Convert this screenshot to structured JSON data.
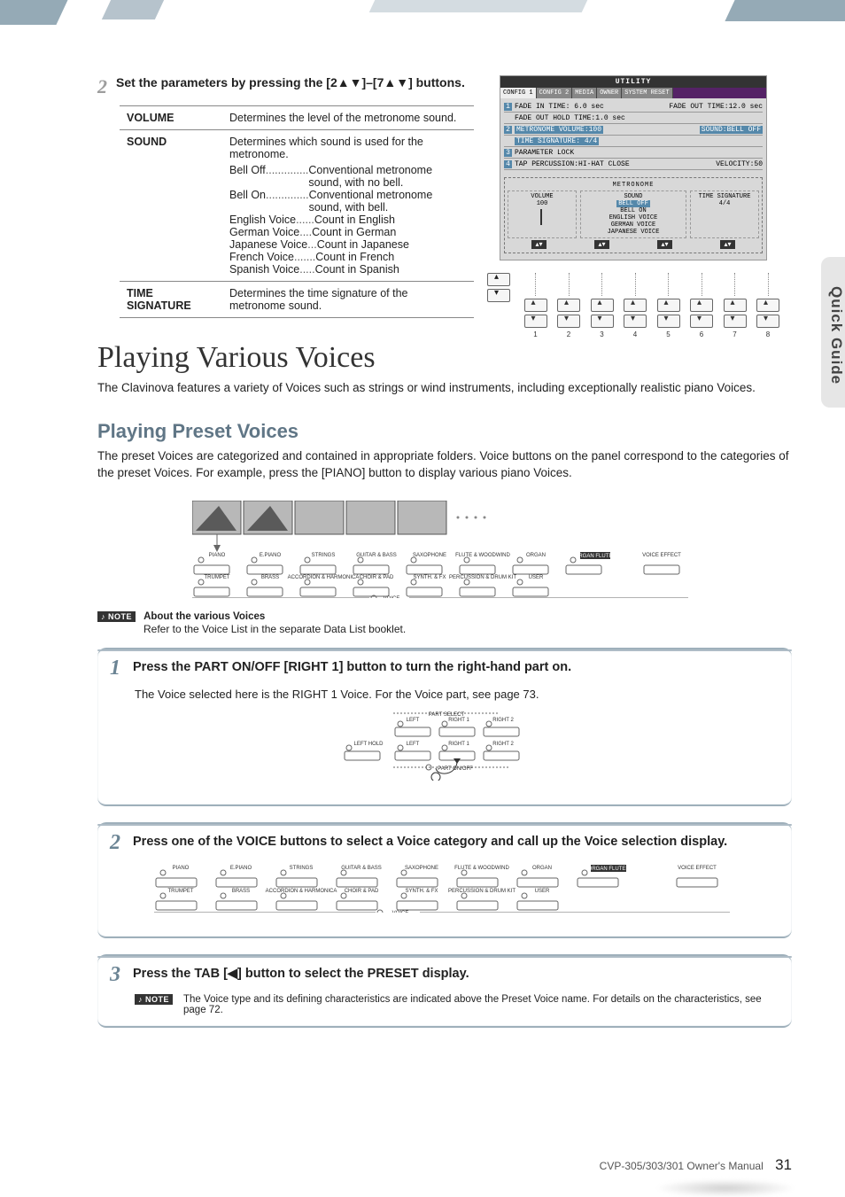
{
  "side_tab": "Quick Guide",
  "step2": {
    "num": "2",
    "text": "Set the parameters by pressing the [2▲▼]–[7▲▼] buttons."
  },
  "param_table": {
    "rows": [
      {
        "key": "VOLUME",
        "desc": "Determines the level of the metronome sound."
      },
      {
        "key": "SOUND",
        "desc": "Determines which sound is used for the metronome.",
        "items": [
          {
            "k": "Bell Off",
            "dots": "..............",
            "v": "Conventional metronome sound, with no bell."
          },
          {
            "k": "Bell On",
            "dots": "..............",
            "v": "Conventional metronome sound, with bell."
          },
          {
            "k": "English Voice",
            "dots": " ......",
            "v": "Count in English"
          },
          {
            "k": "German Voice",
            "dots": " ....",
            "v": "Count in German"
          },
          {
            "k": "Japanese Voice",
            "dots": " ...",
            "v": "Count in Japanese"
          },
          {
            "k": "French Voice",
            "dots": ".......",
            "v": "Count in French"
          },
          {
            "k": "Spanish Voice",
            "dots": " .....",
            "v": "Count in Spanish"
          }
        ]
      },
      {
        "key": "TIME SIGNATURE",
        "desc": "Determines the time signature of the metronome sound."
      }
    ]
  },
  "utility": {
    "title": "UTILITY",
    "tabs": [
      "CONFIG 1",
      "CONFIG 2",
      "MEDIA",
      "OWNER",
      "SYSTEM RESET"
    ],
    "rows": {
      "r1a": "FADE IN TIME: 6.0 sec",
      "r1b": "FADE OUT TIME:12.0 sec",
      "r1c": "FADE OUT HOLD TIME:1.0 sec",
      "r2a": "METRONOME VOLUME:100",
      "r2b": "SOUND:BELL OFF",
      "r2c": "TIME SIGNATURE:  4/4",
      "r3": "PARAMETER LOCK",
      "r4a": "TAP PERCUSSION:HI-HAT CLOSE",
      "r4b": "VELOCITY:50"
    },
    "metronome": {
      "title": "METRONOME",
      "vol_label": "VOLUME",
      "vol_val": "100",
      "sound_label": "SOUND",
      "sound_sel": "BELL OFF",
      "sounds": [
        "BELL ON",
        "ENGLISH VOICE",
        "GERMAN VOICE",
        "JAPANESE VOICE"
      ],
      "ts_label": "TIME SIGNATURE",
      "ts_val": "4/4"
    },
    "button_numbers": [
      "1",
      "2",
      "3",
      "4",
      "5",
      "6",
      "7",
      "8"
    ]
  },
  "section": {
    "title": "Playing Various Voices",
    "body": "The Clavinova features a variety of Voices such as strings or wind instruments, including exceptionally realistic piano Voices."
  },
  "subsection": {
    "title": "Playing Preset Voices",
    "body": "The preset Voices are categorized and contained in appropriate folders. Voice buttons on the panel correspond to the categories of the preset Voices. For example, press the [PIANO] button to display various piano Voices."
  },
  "voice_categories_row1": [
    "PIANO",
    "E.PIANO",
    "STRINGS",
    "GUITAR & BASS",
    "SAXOPHONE",
    "FLUTE & WOODWIND",
    "ORGAN",
    "ORGAN FLUTES"
  ],
  "voice_categories_row2": [
    "TRUMPET",
    "BRASS",
    "ACCORDION & HARMONICA",
    "CHOIR & PAD",
    "SYNTH. & FX",
    "PERCUSSION & DRUM KIT",
    "USER"
  ],
  "voice_effect": "VOICE EFFECT",
  "voice_group_label": "VOICE",
  "note_about": {
    "tag": "♪ NOTE",
    "label": "About the various Voices",
    "body": "Refer to the Voice List in the separate Data List booklet."
  },
  "proc1": {
    "num": "1",
    "title": "Press the PART ON/OFF [RIGHT 1] button to turn the right-hand part on.",
    "body": "The Voice selected here is the RIGHT 1 Voice. For the Voice part, see page 73.",
    "part_select": {
      "group_top": "PART SELECT",
      "labels_top": [
        "LEFT",
        "RIGHT 1",
        "RIGHT 2"
      ],
      "left_hold": "LEFT HOLD",
      "labels_mid": [
        "LEFT",
        "RIGHT 1",
        "RIGHT 2"
      ],
      "group_bottom": "PART ON/OFF"
    }
  },
  "proc2": {
    "num": "2",
    "title": "Press one of the VOICE buttons to select a Voice category and call up the Voice selection display."
  },
  "proc3": {
    "num": "3",
    "title": "Press the TAB [◀] button to select the PRESET display.",
    "note": "The Voice type and its defining characteristics are indicated above the Preset Voice name. For details on the characteristics, see page 72."
  },
  "footer": {
    "model": "CVP-305/303/301 Owner's Manual",
    "page": "31"
  }
}
